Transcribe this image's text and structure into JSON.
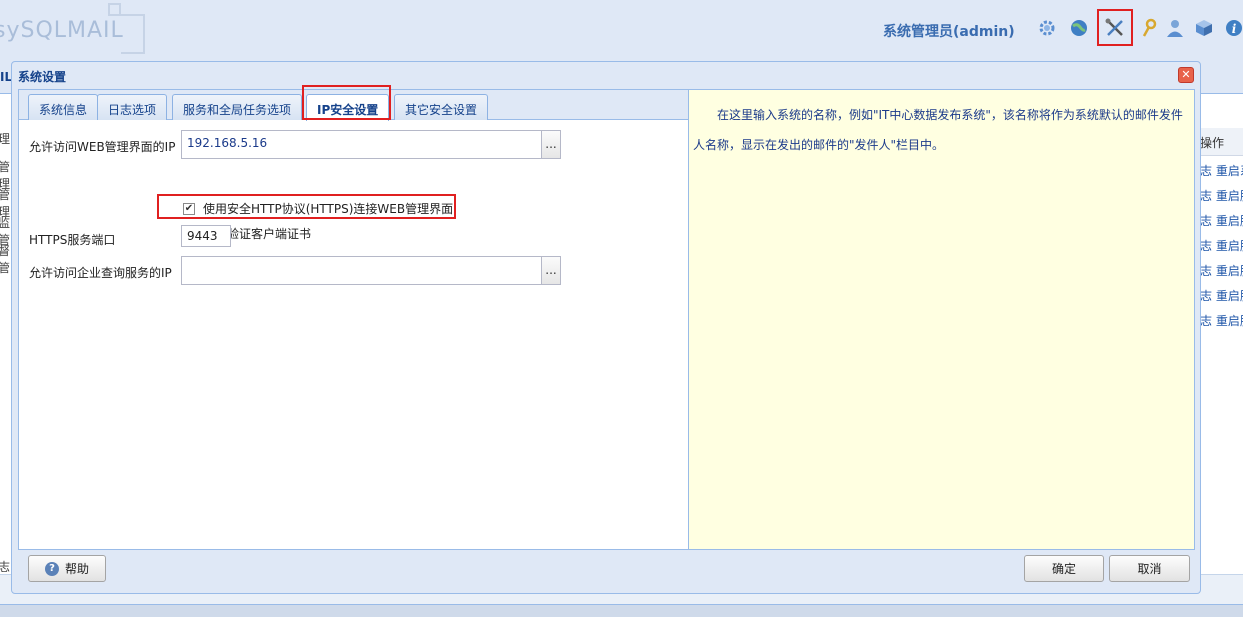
{
  "app": {
    "logo_text": "sySQLMAIL",
    "admin_label": "系统管理员(admin)",
    "header_icons": [
      "gear-icon",
      "globe-icon",
      "tools-icon",
      "key-icon",
      "user-icon",
      "box-icon",
      "info-icon"
    ],
    "selected_icon": "tools-icon"
  },
  "background": {
    "left_fragments": [
      "IL",
      "理",
      "管理",
      "管理",
      "监管",
      "督管",
      "志"
    ],
    "right_header": "操作",
    "right_rows": [
      "志 重启系",
      "志 重启服",
      "志 重启服",
      "志 重启服",
      "志 重启服",
      "志 重启服",
      "志 重启服"
    ]
  },
  "dialog": {
    "title": "系统设置",
    "tabs": [
      {
        "label": "系统信息",
        "active": false
      },
      {
        "label": "日志选项",
        "active": false
      },
      {
        "label": "服务和全局任务选项",
        "active": false
      },
      {
        "label": "IP安全设置",
        "active": true
      },
      {
        "label": "其它安全设置",
        "active": false
      }
    ],
    "form": {
      "web_ip_label": "允许访问WEB管理界面的IP",
      "web_ip_value": "192.168.5.16",
      "trigger_label": "...",
      "https_checkbox_label": "使用安全HTTP协议(HTTPS)连接WEB管理界面",
      "https_checked": true,
      "client_cert_label": "需要验证客户端证书",
      "client_cert_checked": false,
      "https_port_label": "HTTPS服务端口",
      "https_port_value": "9443",
      "query_ip_label": "允许访问企业查询服务的IP",
      "query_ip_value": ""
    },
    "help_text": "在这里输入系统的名称，例如\"IT中心数据发布系统\"，该名称将作为系统默认的邮件发件人名称，显示在发出的邮件的\"发件人\"栏目中。",
    "buttons": {
      "help": "帮助",
      "ok": "确定",
      "cancel": "取消"
    }
  },
  "colors": {
    "accent": "#15428b",
    "highlight": "#e02020",
    "help_bg": "#ffffe1"
  }
}
